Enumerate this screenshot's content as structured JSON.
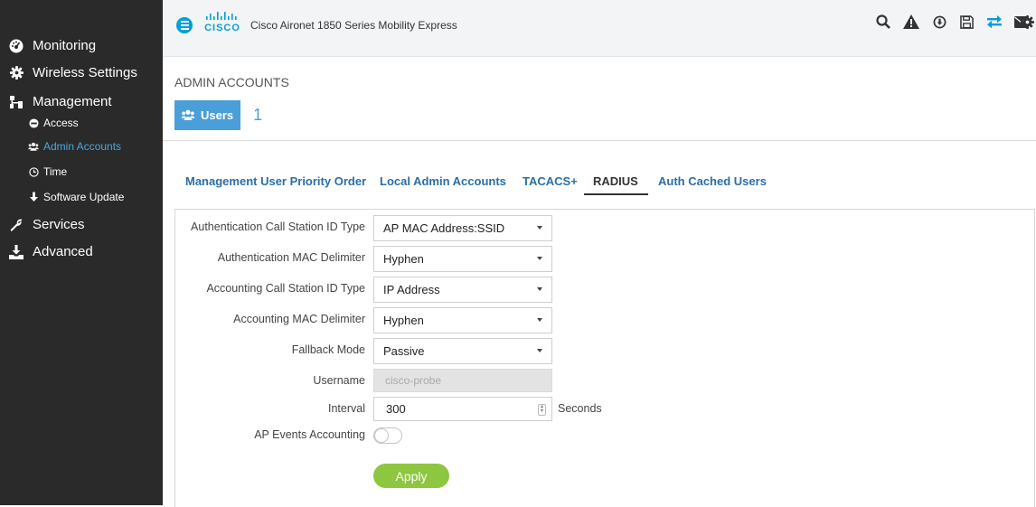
{
  "app": {
    "logo_text": "CISCO",
    "product_title": "Cisco Aironet 1850 Series Mobility Express"
  },
  "sidebar": {
    "items": [
      {
        "label": "Monitoring",
        "icon": "dashboard-icon"
      },
      {
        "label": "Wireless Settings",
        "icon": "gear-icon"
      },
      {
        "label": "Management",
        "icon": "sitemap-icon",
        "children": [
          {
            "label": "Access",
            "icon": "minus-circle-icon"
          },
          {
            "label": "Admin Accounts",
            "icon": "users-icon",
            "active": true
          },
          {
            "label": "Time",
            "icon": "clock-icon"
          },
          {
            "label": "Software Update",
            "icon": "arrow-down-icon"
          }
        ]
      },
      {
        "label": "Services",
        "icon": "wrench-icon"
      },
      {
        "label": "Advanced",
        "icon": "download-tray-icon"
      }
    ]
  },
  "toolbar_icons": [
    "search-icon",
    "warning-icon",
    "download-circle-icon",
    "save-icon",
    "exchange-icon",
    "envelope-icon",
    "gear-icon"
  ],
  "page": {
    "section_title": "ADMIN ACCOUNTS",
    "users_badge": {
      "label": "Users",
      "count": "1"
    }
  },
  "tabs": [
    {
      "label": "Management User Priority Order"
    },
    {
      "label": "Local Admin Accounts"
    },
    {
      "label": "TACACS+"
    },
    {
      "label": "RADIUS",
      "active": true
    },
    {
      "label": "Auth Cached Users"
    }
  ],
  "form": {
    "auth_call_station_id_type": {
      "label": "Authentication Call Station ID Type",
      "value": "AP MAC Address:SSID"
    },
    "auth_mac_delimiter": {
      "label": "Authentication MAC Delimiter",
      "value": "Hyphen"
    },
    "acct_call_station_id_type": {
      "label": "Accounting Call Station ID Type",
      "value": "IP Address"
    },
    "acct_mac_delimiter": {
      "label": "Accounting MAC Delimiter",
      "value": "Hyphen"
    },
    "fallback_mode": {
      "label": "Fallback Mode",
      "value": "Passive"
    },
    "username": {
      "label": "Username",
      "placeholder": "cisco-probe"
    },
    "interval": {
      "label": "Interval",
      "value": "300",
      "unit": "Seconds"
    },
    "ap_events_accounting": {
      "label": "AP Events Accounting",
      "enabled": false
    },
    "apply_label": "Apply"
  },
  "colors": {
    "sidebar_bg": "#2a2a2a",
    "accent": "#049fd9",
    "link": "#2a6ea8",
    "apply": "#8dc63f"
  }
}
